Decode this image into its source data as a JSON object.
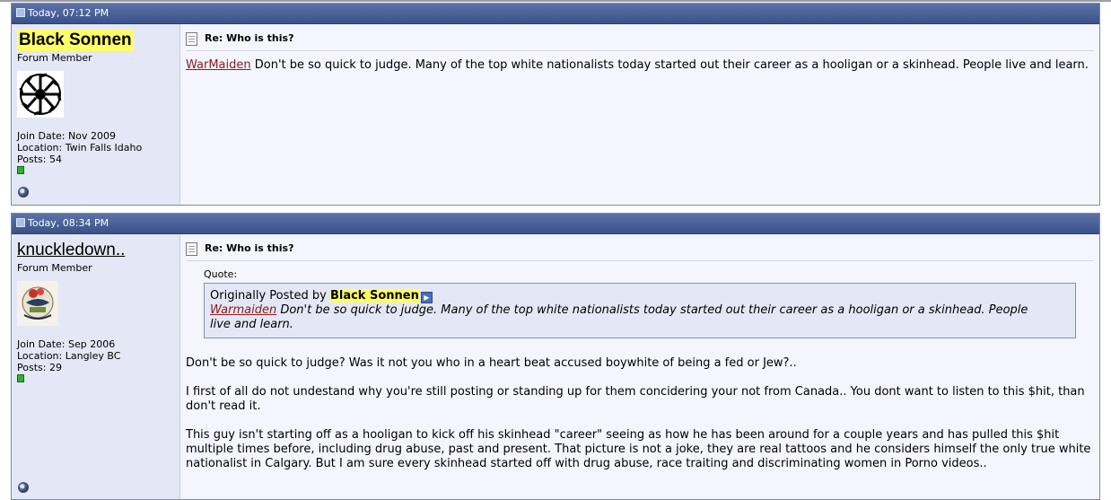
{
  "posts": [
    {
      "timestamp": "Today, 07:12 PM",
      "username": "Black Sonnen",
      "user_title": "Forum Member",
      "join_date": "Join Date: Nov 2009",
      "location": "Location: Twin Falls Idaho",
      "posts": "Posts: 54",
      "title": "Re: Who is this?",
      "mention": "WarMaiden",
      "message": " Don't be so quick to judge. Many of the top white nationalists today started out their career as a hooligan or a skinhead. People live and learn."
    },
    {
      "timestamp": "Today, 08:34 PM",
      "username": "knuckledown..",
      "user_title": "Forum Member",
      "join_date": "Join Date: Sep 2006",
      "location": "Location: Langley BC",
      "posts": "Posts: 29",
      "title": "Re: Who is this?",
      "quote_label": "Quote:",
      "quote_prefix": "Originally Posted by ",
      "quote_author": "Black Sonnen",
      "quote_mention": "Warmaiden",
      "quote_text": " Don't be so quick to judge. Many of the top white nationalists today started out their career as a hooligan or a skinhead. People live and learn.",
      "paragraphs": [
        "Don't be so quick to judge? Was it not you who in a heart beat accused boywhite of being a fed or Jew?..",
        "I first of all do not undestand why you're still posting or standing up for them concidering your not from Canada.. You dont want to listen to this $hit, than don't read it.",
        "This guy isn't starting off as a hooligan to kick off his skinhead \"career\" seeing as how he has been around for a couple years and has pulled this $hit multiple times before, including drug abuse, past and present. That picture is not a joke, they are real tattoos and he considers himself the only true white nationalist in Calgary. But I am sure every skinhead started off with drug abuse, race traiting and discriminating women in Porno videos.."
      ]
    }
  ],
  "icons": {
    "post_status": "post-status-icon",
    "post_doc": "document-icon",
    "reputation": "reputation-icon",
    "online": "online-status-icon",
    "view_post": "view-post-arrow-icon"
  },
  "colors": {
    "header": "#3a5189",
    "username_highlight": "#ffff66",
    "mention_link": "#8b1a1a",
    "reputation": "#2bb32b"
  }
}
